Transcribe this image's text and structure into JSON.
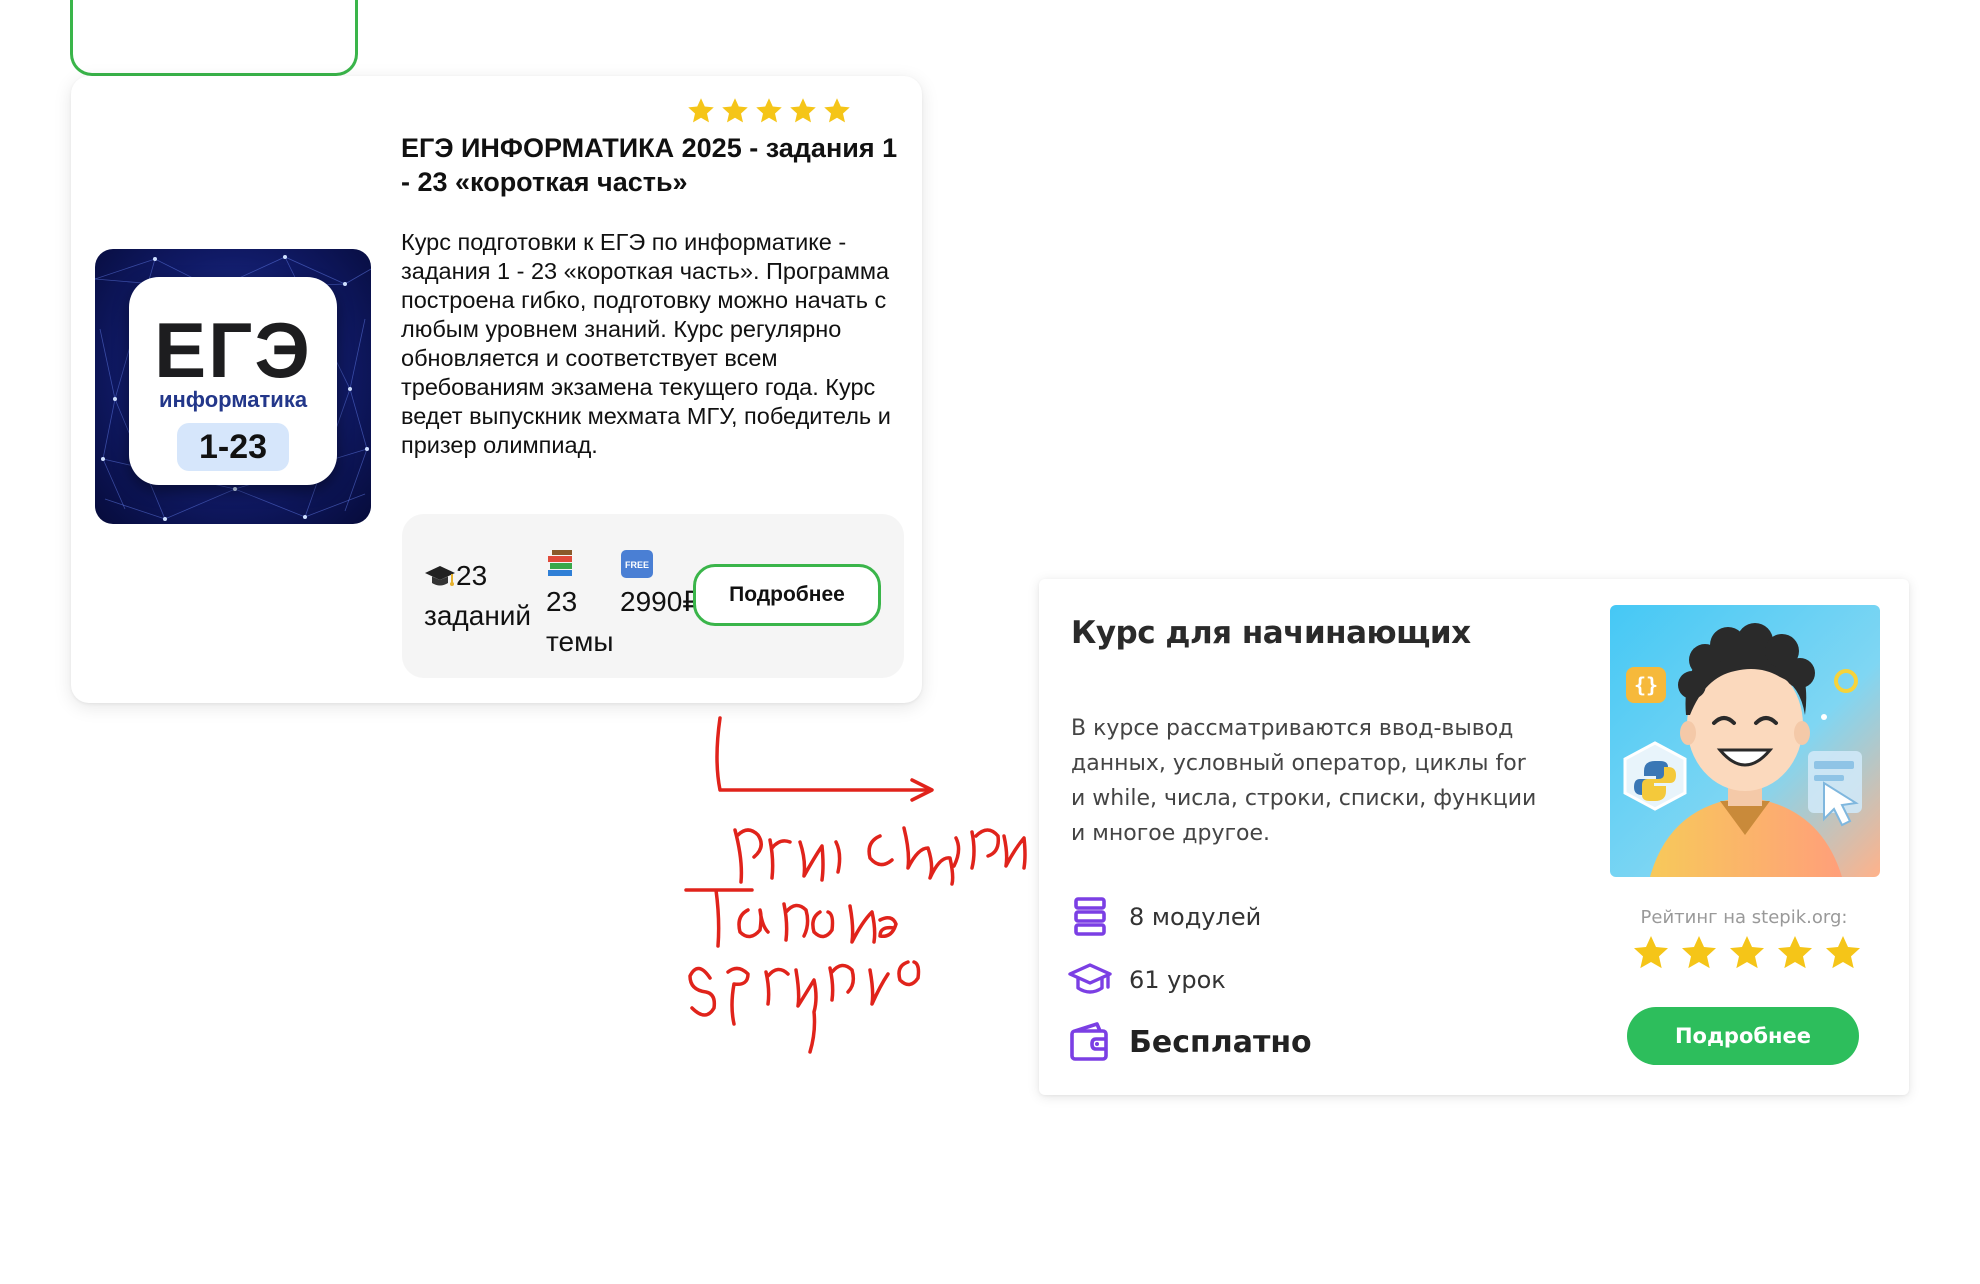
{
  "card1": {
    "rating_stars": 5,
    "title": "ЕГЭ ИНФОРМАТИКА 2025 - задания 1 - 23 «короткая часть»",
    "description": "Курс подготовки к ЕГЭ по информатике - задания 1 - 23 «короткая часть». Программа построена гибко, подготовку можно начать с любым уровнем знаний. Курс регулярно обновляется и соответствует всем требованиям экзамена текущего года. Курс ведет выпускник мехмата МГУ, победитель и призер олимпиад.",
    "cover": {
      "heading": "ЕГЭ",
      "subheading": "информатика",
      "badge": "1-23"
    },
    "stats": {
      "tasks": "23 заданий",
      "topics": "23 темы",
      "price": "2990₽"
    },
    "button_label": "Подробнее",
    "icons": {
      "tasks": "graduation-cap-icon",
      "topics": "books-icon",
      "price": "free-badge-icon"
    }
  },
  "card2": {
    "title": "Курс для начинающих",
    "description": "В курсе рассматриваются ввод-вывод данных, условный оператор, циклы for и while, числа, строки, списки, функции и многое другое.",
    "features": {
      "modules": "8 модулей",
      "lessons": "61 урок",
      "price": "Бесплатно"
    },
    "rating_label": "Рейтинг на stepik.org:",
    "rating_stars": 5,
    "button_label": "Подробнее",
    "icons": {
      "modules": "stack-icon",
      "lessons": "graduation-cap-icon",
      "price": "wallet-icon"
    }
  },
  "colors": {
    "star": "#f5c518",
    "green_outline": "#3ab54a",
    "green_button": "#2dbe5c",
    "purple_icon": "#7b3fe4",
    "annotation_red": "#e0231b"
  }
}
